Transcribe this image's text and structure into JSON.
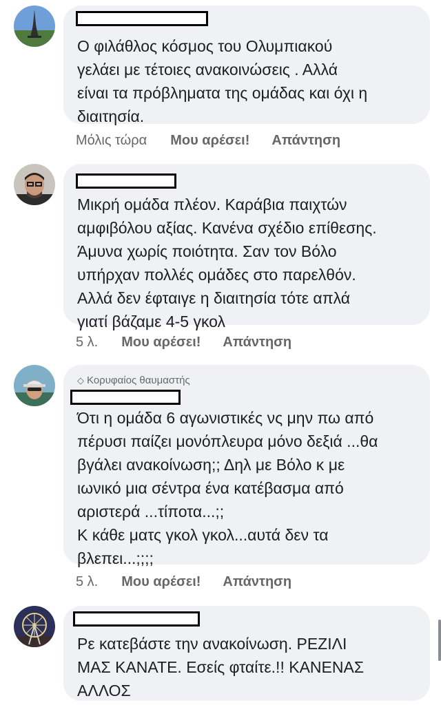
{
  "comments": [
    {
      "avatar": "eiffel-tower-avatar",
      "badge": "",
      "text": "Ο φιλάθλος κόσμος του Ολυμπιακού\nγελάει με τέτοιες ανακοινώσεις . Αλλά\nείναι τα πρόβληματα της ομάδας και όχι η\nδιαιτησία.",
      "time": "Μόλις τώρα",
      "like": "Μου αρέσει!",
      "reply": "Απάντηση"
    },
    {
      "avatar": "man-with-glasses-avatar",
      "badge": "",
      "text": "Μικρή ομάδα πλέον. Καράβια παιχτών\nαμφιβόλου αξίας. Κανένα σχέδιο επίθεσης.\nΆμυνα χωρίς ποιότητα. Σαν τον Βόλο\nυπήρχαν πολλές ομάδες στο παρελθόν.\nΑλλά δεν έφταιγε η διαιτησία τότε απλά\nγιατί βάζαμε 4-5 γκολ",
      "time": "5 λ.",
      "like": "Μου αρέσει!",
      "reply": "Απάντηση"
    },
    {
      "avatar": "man-in-cap-avatar",
      "badge": "Κορυφαίος θαυμαστής",
      "text": "Ότι η ομάδα 6 αγωνιστικές νς μην πω από\nπέρυσι παίζει μονόπλευρα μόνο δεξιά ...θα\nβγάλει ανακοίνωση;; Δηλ με Βόλο κ με\nιωνικό μια σέντρα ένα κατέβασμα από\nαριστερά ...τίποτα...;;\nΚ κάθε ματς γκολ γκολ...αυτά δεν τα\nβλεπει...;;;;",
      "time": "5 λ.",
      "like": "Μου αρέσει!",
      "reply": "Απάντηση"
    },
    {
      "avatar": "ferris-wheel-avatar",
      "badge": "",
      "text": "Ρε κατεβάστε την ανακοίνωση. ΡΕΖΙΛΙ\nΜΑΣ ΚΑΝΑΤΕ. Εσείς φταίτε.!! ΚΑΝΕΝΑΣ\nΑΛΛΟΣ"
    }
  ],
  "colors": {
    "bubble": "#eff1f4",
    "meta": "#65676b",
    "text": "#1c1e21"
  }
}
